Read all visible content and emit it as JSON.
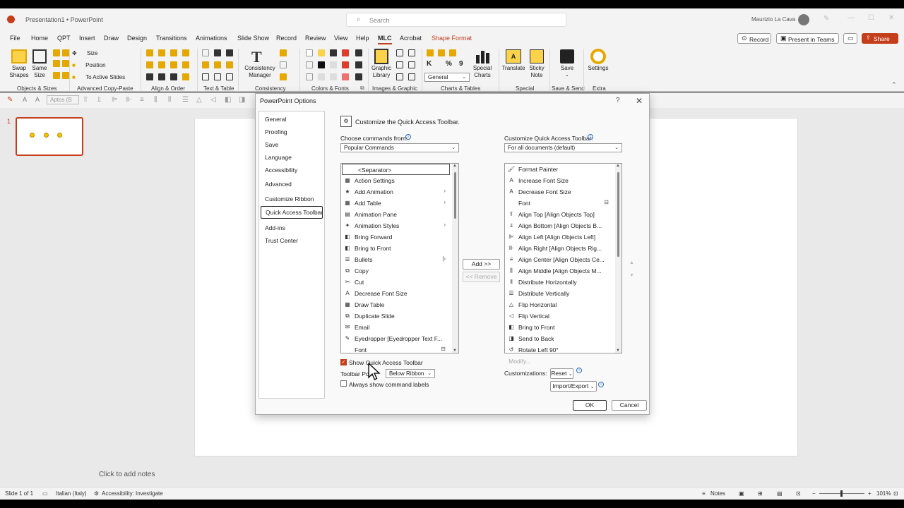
{
  "titlebar": {
    "doc_title": "Presentation1 • PowerPoint",
    "search_placeholder": "Search",
    "user_name": "Maurizio La Cava"
  },
  "menu": [
    "File",
    "Home",
    "QPT",
    "Insert",
    "Draw",
    "Design",
    "Transitions",
    "Animations",
    "Slide Show",
    "Record",
    "Review",
    "View",
    "Help",
    "MLC",
    "Acrobat",
    "Shape Format"
  ],
  "menu_right": {
    "record": "Record",
    "present": "Present in Teams",
    "share": "Share"
  },
  "ribbon": {
    "swap_shapes": "Swap Shapes",
    "same_size": "Same Size",
    "size": "Size",
    "position": "Position",
    "to_active_slides": "To Active Slides",
    "consistency_manager": "Consistency Manager",
    "graphic_library": "Graphic Library",
    "general": "General",
    "special_charts": "Special Charts",
    "translate": "Translate",
    "sticky_note": "Sticky Note",
    "save": "Save",
    "settings": "Settings",
    "groups": [
      "Objects & Sizes",
      "Advanced Copy-Paste",
      "Align & Order",
      "Text & Table",
      "Consistency",
      "Colors & Fonts",
      "Images & Graphic",
      "Charts & Tables",
      "Special",
      "Save & Send",
      "Extra"
    ]
  },
  "qat": {
    "font_box": "Aptos (B"
  },
  "slide_panel": {
    "slide_number": "1"
  },
  "notes": {
    "placeholder": "Click to add notes"
  },
  "status": {
    "slide_of": "Slide 1 of 1",
    "language": "Italian (Italy)",
    "accessibility": "Accessibility: Investigate",
    "notes": "Notes",
    "zoom": "101%"
  },
  "dialog": {
    "title": "PowerPoint Options",
    "help": "?",
    "close": "✕",
    "nav": [
      "General",
      "Proofing",
      "Save",
      "Language",
      "Accessibility",
      "Advanced",
      "Customize Ribbon",
      "Quick Access Toolbar",
      "Add-ins",
      "Trust Center"
    ],
    "heading": "Customize the Quick Access Toolbar.",
    "choose_label": "Choose commands from:",
    "choose_value": "Popular Commands",
    "customize_label": "Customize Quick Access Toolbar:",
    "customize_value": "For all documents (default)",
    "left_list": [
      {
        "text": "<Separator>",
        "icon": ""
      },
      {
        "text": "Action Settings",
        "icon": "▦"
      },
      {
        "text": "Add Animation",
        "icon": "★",
        "sub": "›"
      },
      {
        "text": "Add Table",
        "icon": "▦",
        "sub": "›"
      },
      {
        "text": "Animation Pane",
        "icon": "▤"
      },
      {
        "text": "Animation Styles",
        "icon": "✦",
        "sub": "›"
      },
      {
        "text": "Bring Forward",
        "icon": "◧"
      },
      {
        "text": "Bring to Front",
        "icon": "◧"
      },
      {
        "text": "Bullets",
        "icon": "☰",
        "sub": "|›"
      },
      {
        "text": "Copy",
        "icon": "⧉"
      },
      {
        "text": "Cut",
        "icon": "✂"
      },
      {
        "text": "Decrease Font Size",
        "icon": "A"
      },
      {
        "text": "Draw Table",
        "icon": "▦"
      },
      {
        "text": "Duplicate Slide",
        "icon": "⧉"
      },
      {
        "text": "Email",
        "icon": "✉"
      },
      {
        "text": "Eyedropper [Eyedropper Text F...",
        "icon": "✎"
      },
      {
        "text": "Font",
        "icon": "",
        "sub": "⊟"
      }
    ],
    "right_list": [
      {
        "text": "Format Painter",
        "icon": "🖌"
      },
      {
        "text": "Increase Font Size",
        "icon": "A"
      },
      {
        "text": "Decrease Font Size",
        "icon": "A"
      },
      {
        "text": "Font",
        "icon": "",
        "sub": "⊟"
      },
      {
        "text": "Align Top [Align Objects Top]",
        "icon": "⫪"
      },
      {
        "text": "Align Bottom [Align Objects B...",
        "icon": "⫫"
      },
      {
        "text": "Align Left [Align Objects Left]",
        "icon": "⊫"
      },
      {
        "text": "Align Right [Align Objects Rig...",
        "icon": "⊪"
      },
      {
        "text": "Align Center [Align Objects Ce...",
        "icon": "≡"
      },
      {
        "text": "Align Middle [Align Objects M...",
        "icon": "⫼"
      },
      {
        "text": "Distribute Horizontally",
        "icon": "⫴"
      },
      {
        "text": "Distribute Vertically",
        "icon": "☰"
      },
      {
        "text": "Flip Horizontal",
        "icon": "△"
      },
      {
        "text": "Flip Vertical",
        "icon": "◁"
      },
      {
        "text": "Bring to Front",
        "icon": "◧"
      },
      {
        "text": "Send to Back",
        "icon": "◨"
      },
      {
        "text": "Rotate Left 90°",
        "icon": "↺"
      }
    ],
    "add_button": "Add >>",
    "remove_button": "<< Remove",
    "modify_button": "Modify...",
    "customizations_label": "Customizations:",
    "reset_button": "Reset",
    "import_export_button": "Import/Export",
    "show_qat_label": "Show Quick Access Toolbar",
    "toolbar_pos_label": "Toolbar Pos",
    "toolbar_pos_value": "Below Ribbon",
    "always_show_label": "Always show command labels",
    "ok_button": "OK",
    "cancel_button": "Cancel"
  },
  "colors": {
    "accent": "#c43e1c",
    "slide_dot": "#f5c400"
  }
}
